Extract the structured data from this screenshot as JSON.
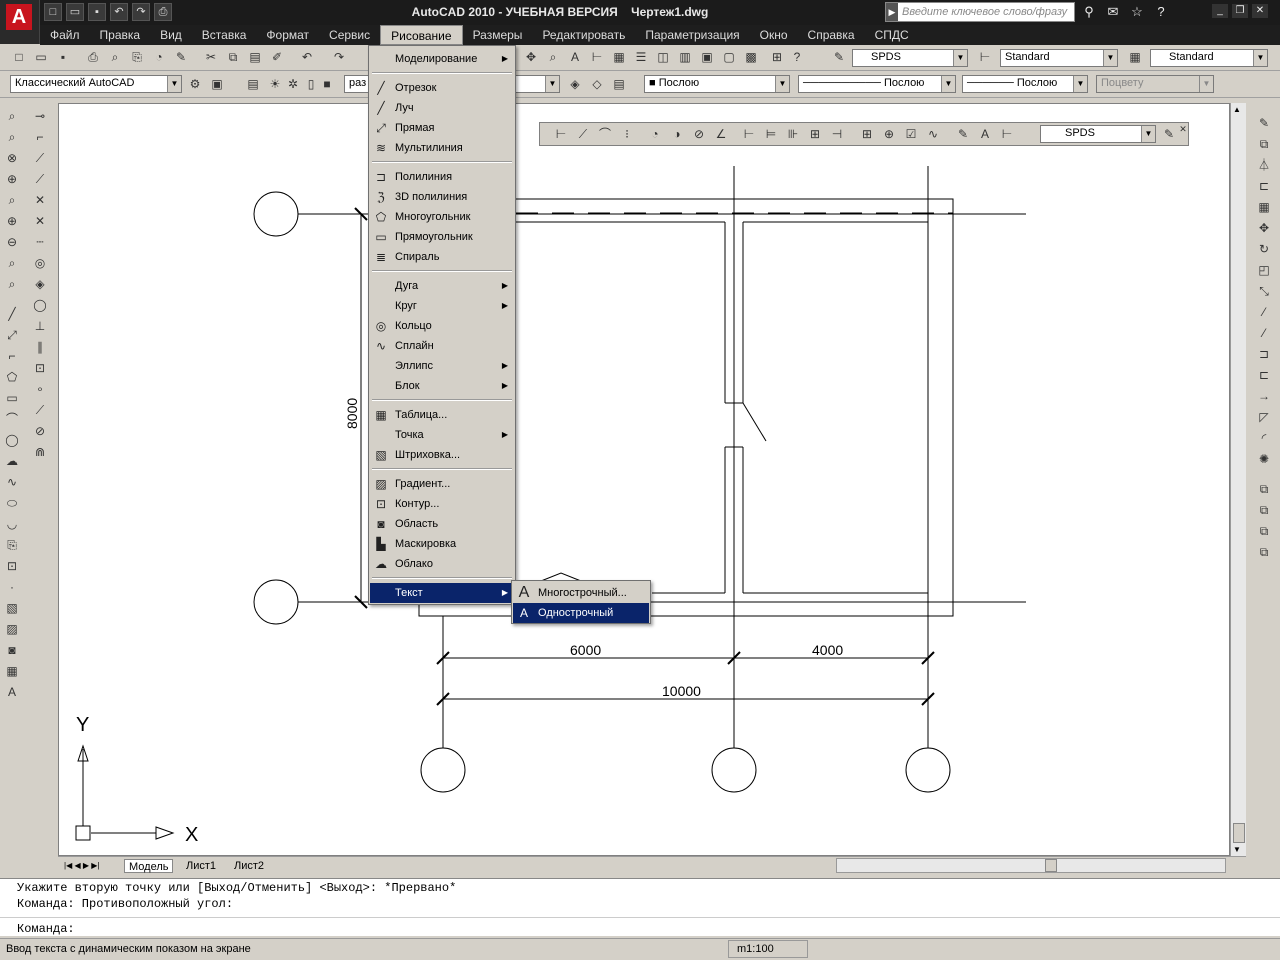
{
  "title": {
    "app": "AutoCAD 2010 - УЧЕБНАЯ ВЕРСИЯ",
    "file": "Чертеж1.dwg"
  },
  "search_placeholder": "Введите ключевое слово/фразу",
  "menu": [
    "Файл",
    "Правка",
    "Вид",
    "Вставка",
    "Формат",
    "Сервис",
    "Рисование",
    "Размеры",
    "Редактировать",
    "Параметризация",
    "Окно",
    "Справка",
    "СПДС"
  ],
  "toolbar": {
    "text_style": "SPDS",
    "dim_style": "Standard",
    "table_style": "Standard",
    "workspace": "Классический AutoCAD",
    "layer_fragment": "раз",
    "color": "Послою",
    "linetype": "Послою",
    "lineweight": "Послою",
    "plotstyle": "Поцвету",
    "dim_float_style": "SPDS"
  },
  "draw_menu": {
    "modeling": "Моделирование",
    "segment": "Отрезок",
    "ray": "Луч",
    "xline": "Прямая",
    "mline": "Мультилиния",
    "pline": "Полилиния",
    "pline3d": "3D полилиния",
    "polygon": "Многоугольник",
    "rectangle": "Прямоугольник",
    "helix": "Спираль",
    "arc": "Дуга",
    "circle": "Круг",
    "donut": "Кольцо",
    "spline": "Сплайн",
    "ellipse": "Эллипс",
    "block": "Блок",
    "table": "Таблица...",
    "point": "Точка",
    "hatch": "Штриховка...",
    "gradient": "Градиент...",
    "boundary": "Контур...",
    "region": "Область",
    "wipeout": "Маскировка",
    "cloud": "Облако",
    "text": "Текст"
  },
  "text_submenu": {
    "mtext": "Многострочный...",
    "dtext": "Однострочный"
  },
  "drawing": {
    "dim_6000": "6000",
    "dim_4000": "4000",
    "dim_10000": "10000",
    "dim_8000": "8000",
    "axis_x": "X",
    "axis_y": "Y"
  },
  "layout_tabs": [
    "Модель",
    "Лист1",
    "Лист2"
  ],
  "command_lines": [
    "Укажите вторую точку или [Выход/Отменить] <Выход>: *Прервано*",
    "Команда: Противоположный угол:",
    "Команда:"
  ],
  "status": {
    "hint": "Ввод текста с динамическим показом на экране",
    "scale": "m1:100"
  }
}
